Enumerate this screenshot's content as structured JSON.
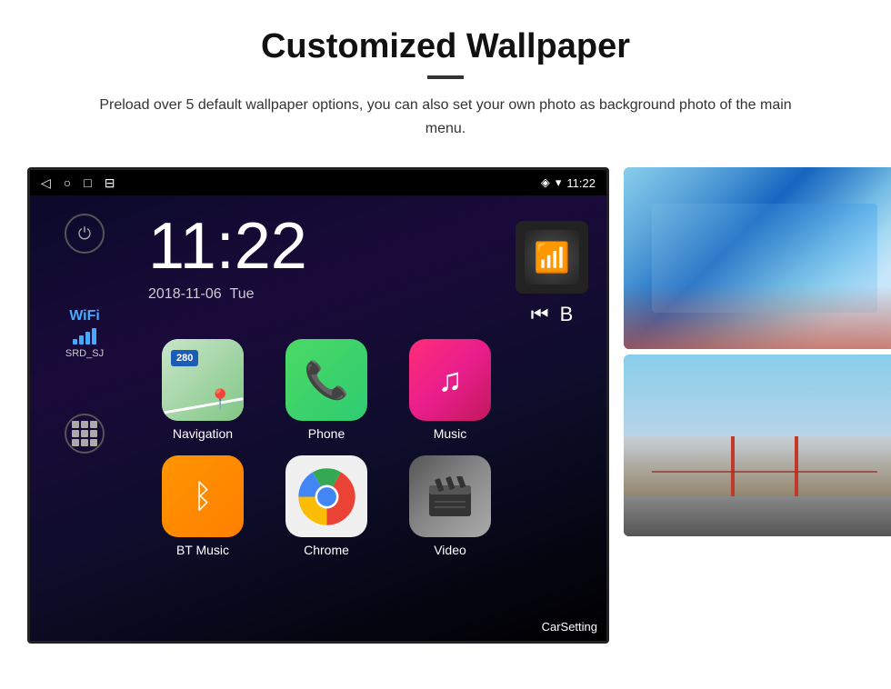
{
  "header": {
    "title": "Customized Wallpaper",
    "subtitle": "Preload over 5 default wallpaper options, you can also set your own photo as background photo of the main menu."
  },
  "device": {
    "status_bar": {
      "time": "11:22",
      "nav_icons": [
        "◁",
        "○",
        "□",
        "⊟"
      ],
      "right_icons": [
        "location",
        "wifi",
        "time"
      ]
    },
    "clock": {
      "time": "11:22",
      "date": "2018-11-06",
      "day": "Tue"
    },
    "wifi": {
      "label": "WiFi",
      "network": "SRD_SJ"
    },
    "apps": [
      {
        "id": "navigation",
        "label": "Navigation",
        "type": "nav"
      },
      {
        "id": "phone",
        "label": "Phone",
        "type": "phone"
      },
      {
        "id": "music",
        "label": "Music",
        "type": "music"
      },
      {
        "id": "bt-music",
        "label": "BT Music",
        "type": "bt"
      },
      {
        "id": "chrome",
        "label": "Chrome",
        "type": "chrome"
      },
      {
        "id": "video",
        "label": "Video",
        "type": "video"
      }
    ],
    "wallpaper_label": "CarSetting"
  },
  "wallpaper_panel": {
    "thumb1_alt": "Ice cave wallpaper",
    "thumb2_alt": "Golden Gate Bridge wallpaper"
  }
}
